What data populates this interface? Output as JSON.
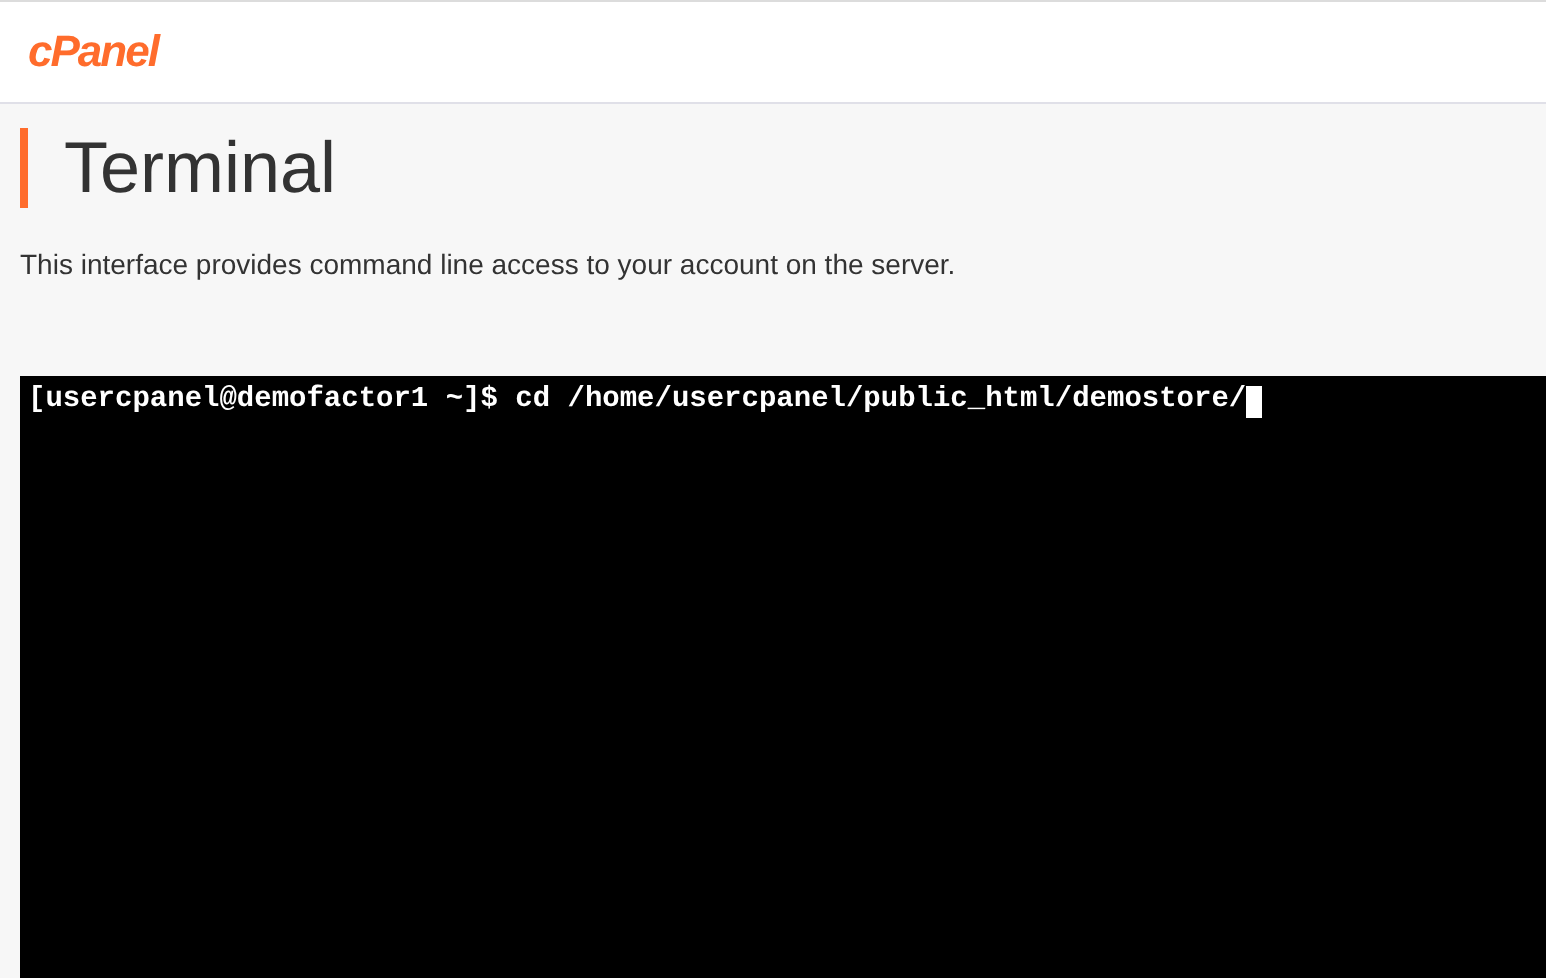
{
  "header": {
    "logo": "cPanel"
  },
  "page": {
    "title": "Terminal",
    "description": "This interface provides command line access to your account on the server."
  },
  "terminal": {
    "lines": [
      "[usercpanel@demofactor1 ~]$ cd /home/usercpanel/public_html/demostore/"
    ],
    "cursor": true
  }
}
